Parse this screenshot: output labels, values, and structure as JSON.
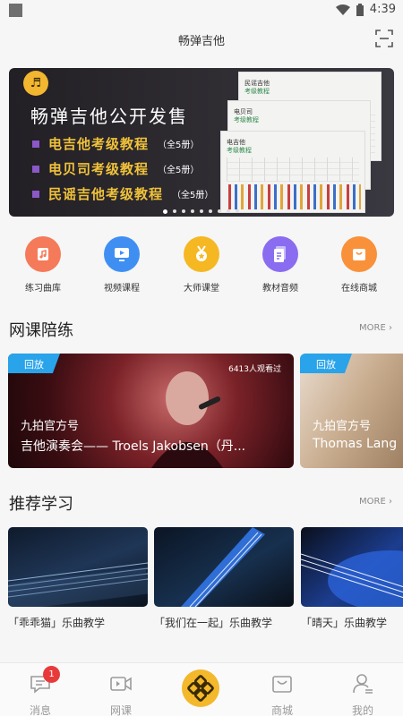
{
  "status": {
    "time": "4:39"
  },
  "header": {
    "title": "畅弹吉他",
    "scan_icon": "scan-icon"
  },
  "banner": {
    "headline": "畅弹吉他公开发售",
    "items": [
      {
        "title": "电吉他考级教程",
        "sub": "（全5册）"
      },
      {
        "title": "电贝司考级教程",
        "sub": "（全5册）"
      },
      {
        "title": "民谣吉他考级教程",
        "sub": "（全5册）"
      }
    ],
    "books": [
      {
        "line1": "民谣吉他",
        "line2": "考级教程"
      },
      {
        "line1": "电贝司",
        "line2": "考级教程"
      },
      {
        "line1": "电吉他",
        "line2": "考级教程"
      }
    ]
  },
  "quick": [
    {
      "label": "练习曲库",
      "icon": "music-sheet-icon",
      "color": "#f47a5a"
    },
    {
      "label": "视频课程",
      "icon": "video-play-icon",
      "color": "#3f8ff2"
    },
    {
      "label": "大师课堂",
      "icon": "medal-icon",
      "color": "#f5b823"
    },
    {
      "label": "教材音频",
      "icon": "document-icon",
      "color": "#8a6cf0"
    },
    {
      "label": "在线商城",
      "icon": "shopping-bag-icon",
      "color": "#f8913a"
    }
  ],
  "live": {
    "title": "网课陪练",
    "more": "MORE",
    "cards": [
      {
        "badge": "回放",
        "views": "6413人观看过",
        "owner": "九拍官方号",
        "title": "吉他演奏会—— Troels Jakobsen（丹..."
      },
      {
        "badge": "回放",
        "views": "",
        "owner": "九拍官方号",
        "title": "Thomas Lang"
      }
    ]
  },
  "recommend": {
    "title": "推荐学习",
    "more": "MORE",
    "items": [
      {
        "caption": "「乖乖猫」乐曲教学"
      },
      {
        "caption": "「我们在一起」乐曲教学"
      },
      {
        "caption": "「晴天」乐曲教学"
      }
    ]
  },
  "tabbar": {
    "badge": "1",
    "tabs": [
      {
        "label": "消息",
        "icon": "message-icon"
      },
      {
        "label": "网课",
        "icon": "video-icon"
      },
      {
        "label": "",
        "icon": "home-logo-icon"
      },
      {
        "label": "商城",
        "icon": "shop-icon"
      },
      {
        "label": "我的",
        "icon": "profile-icon"
      }
    ]
  }
}
